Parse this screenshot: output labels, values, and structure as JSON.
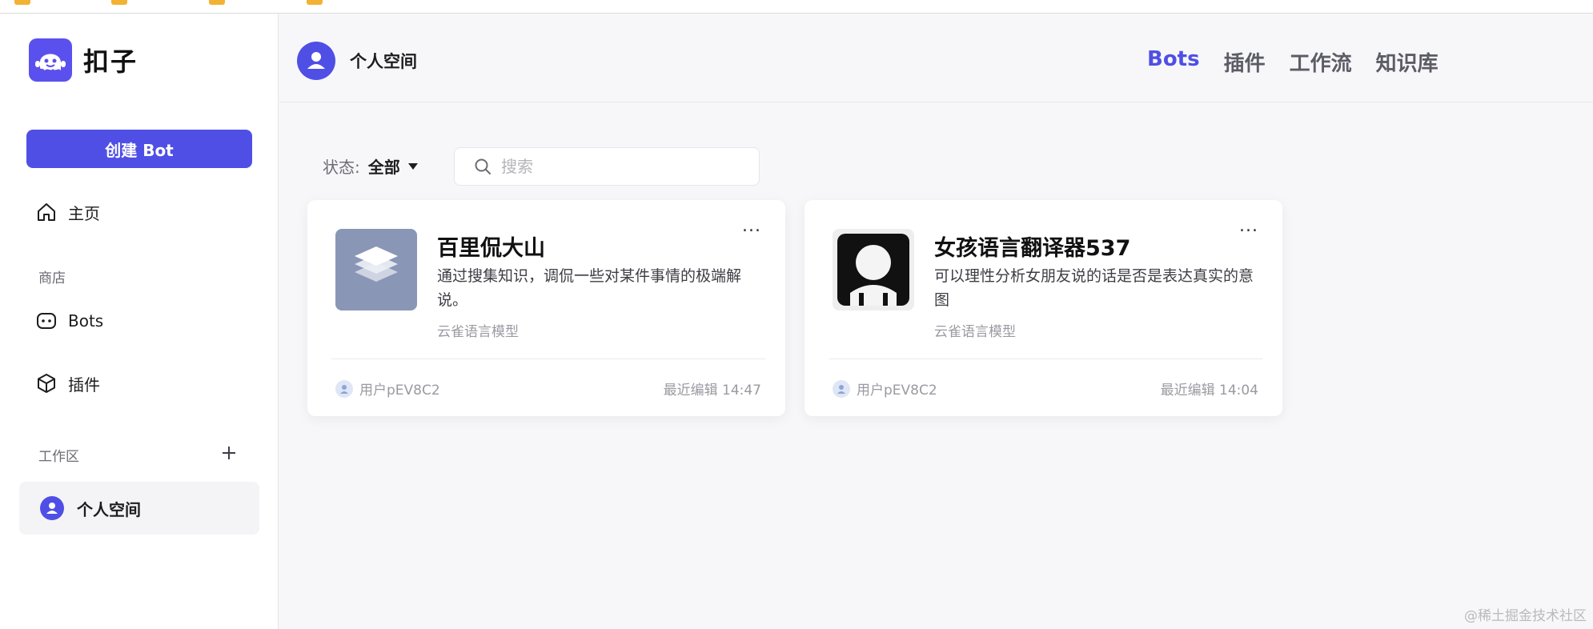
{
  "app": {
    "name": "扣子"
  },
  "sidebar": {
    "create_button": "创建 Bot",
    "home": "主页",
    "store_section": "商店",
    "store_items": [
      {
        "label": "Bots",
        "icon": "bot-icon"
      },
      {
        "label": "插件",
        "icon": "cube-icon"
      }
    ],
    "workspace_section": "工作区",
    "personal_space": "个人空间"
  },
  "header": {
    "space_name": "个人空间",
    "tabs": [
      {
        "label": "Bots",
        "active": true
      },
      {
        "label": "插件",
        "active": false
      },
      {
        "label": "工作流",
        "active": false
      },
      {
        "label": "知识库",
        "active": false
      }
    ]
  },
  "filter": {
    "status_label": "状态:",
    "status_value": "全部",
    "search_placeholder": "搜索"
  },
  "cards": [
    {
      "title": "百里侃大山",
      "description": "通过搜集知识，调侃一些对某件事情的极端解说。",
      "model": "云雀语言模型",
      "user": "用户pEV8C2",
      "edited": "最近编辑 14:47",
      "more": "..."
    },
    {
      "title": "女孩语言翻译器537",
      "description": "可以理性分析女朋友说的话是否是表达真实的意图",
      "model": "云雀语言模型",
      "user": "用户pEV8C2",
      "edited": "最近编辑 14:04",
      "more": "..."
    }
  ],
  "watermark": "@稀土掘金技术社区",
  "colors": {
    "accent": "#4f4fe6",
    "logo": "#5a50ee"
  }
}
